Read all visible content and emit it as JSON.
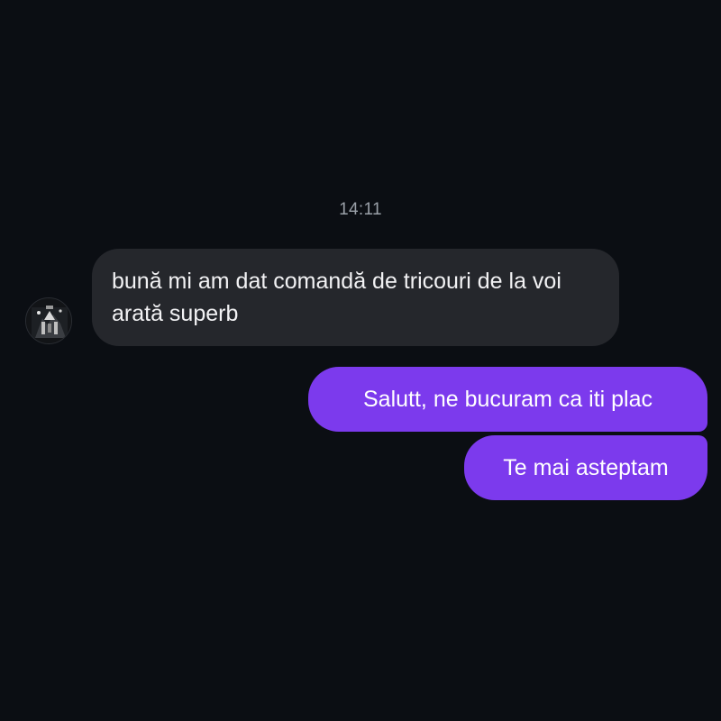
{
  "conversation": {
    "timestamp": "14:11",
    "incoming": {
      "avatar_icon": "user-avatar-icon",
      "text": "bună mi am dat comandă de tricouri de la voi arată superb"
    },
    "outgoing": [
      {
        "text": "Salutt, ne bucuram ca iti plac"
      },
      {
        "text": "Te mai asteptam"
      }
    ]
  },
  "colors": {
    "background": "#0b0e13",
    "incoming_bubble": "#25272c",
    "outgoing_bubble": "#7c3aed",
    "timestamp": "#9aa0a8"
  }
}
